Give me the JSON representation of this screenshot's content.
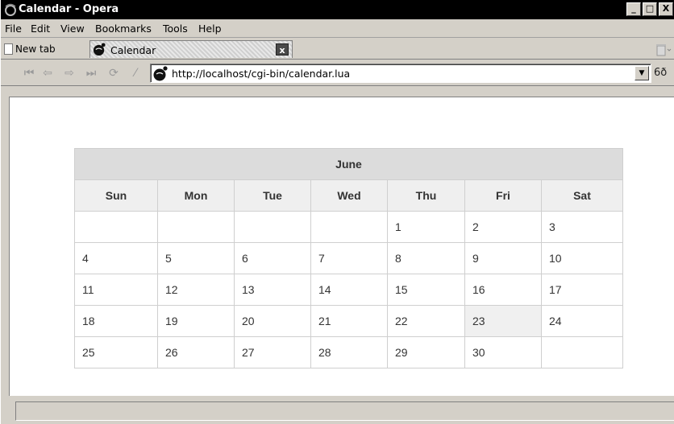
{
  "window": {
    "title": "Calendar - Opera",
    "controls": {
      "minimize": "_",
      "maximize": "□",
      "close": "X"
    }
  },
  "menu": [
    "File",
    "Edit",
    "View",
    "Bookmarks",
    "Tools",
    "Help"
  ],
  "tabs": {
    "new_tab_label": "New tab",
    "active_tab": {
      "label": "Calendar",
      "icon": "opera-globe-icon",
      "close": "x"
    },
    "trash_icon": "trash-icon"
  },
  "navigation": {
    "buttons": [
      "rewind-icon",
      "back-icon",
      "forward-icon",
      "fast-forward-icon",
      "reload-icon",
      "edit-icon"
    ],
    "url": "http://localhost/cgi-bin/calendar.lua",
    "dropdown": "▼",
    "search_edge": "6ð"
  },
  "calendar": {
    "month": "June",
    "weekdays": [
      "Sun",
      "Mon",
      "Tue",
      "Wed",
      "Thu",
      "Fri",
      "Sat"
    ],
    "weeks": [
      [
        "",
        "",
        "",
        "",
        "1",
        "2",
        "3"
      ],
      [
        "4",
        "5",
        "6",
        "7",
        "8",
        "9",
        "10"
      ],
      [
        "11",
        "12",
        "13",
        "14",
        "15",
        "16",
        "17"
      ],
      [
        "18",
        "19",
        "20",
        "21",
        "22",
        "23",
        "24"
      ],
      [
        "25",
        "26",
        "27",
        "28",
        "29",
        "30",
        ""
      ]
    ],
    "highlighted_day": "23"
  },
  "colors": {
    "titlebar": "#000000",
    "chrome": "#d4d0c8",
    "month_header_bg": "#dcdcdc",
    "weekday_header_bg": "#efefef",
    "highlight_bg": "#f0f0f0",
    "border": "#cfcfcf"
  }
}
